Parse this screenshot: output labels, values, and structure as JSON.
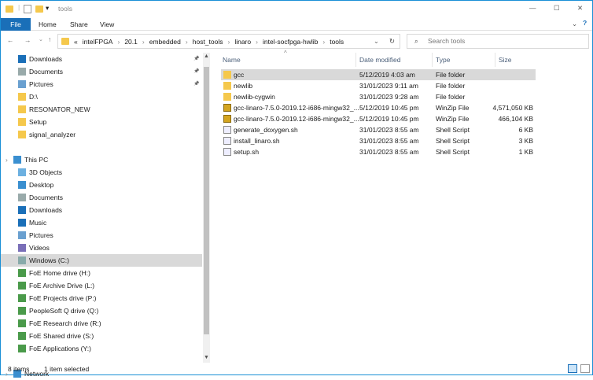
{
  "window": {
    "title": "tools",
    "minimize": "—",
    "maximize": "☐",
    "close": "✕"
  },
  "ribbon": {
    "tabs": [
      "File",
      "Home",
      "Share",
      "View"
    ]
  },
  "address": {
    "overflow": "«",
    "crumbs": [
      "intelFPGA",
      "20.1",
      "embedded",
      "host_tools",
      "linaro",
      "intel-socfpga-hwlib",
      "tools"
    ],
    "search_placeholder": "Search tools"
  },
  "nav": {
    "items": [
      {
        "label": "Downloads",
        "icon": "download-icon",
        "pinned": true
      },
      {
        "label": "Documents",
        "icon": "documents-icon",
        "pinned": true
      },
      {
        "label": "Pictures",
        "icon": "pictures-icon",
        "pinned": true
      },
      {
        "label": "D:\\",
        "icon": "folder-icon"
      },
      {
        "label": "RESONATOR_NEW",
        "icon": "folder-icon"
      },
      {
        "label": "Setup",
        "icon": "folder-icon"
      },
      {
        "label": "signal_analyzer",
        "icon": "folder-icon"
      },
      {
        "label": "",
        "icon": ""
      },
      {
        "label": "This PC",
        "icon": "pc-icon",
        "level": 0
      },
      {
        "label": "3D Objects",
        "icon": "3d-objects-icon"
      },
      {
        "label": "Desktop",
        "icon": "desktop-icon"
      },
      {
        "label": "Documents",
        "icon": "documents-icon"
      },
      {
        "label": "Downloads",
        "icon": "download-icon"
      },
      {
        "label": "Music",
        "icon": "music-icon"
      },
      {
        "label": "Pictures",
        "icon": "pictures-icon"
      },
      {
        "label": "Videos",
        "icon": "videos-icon"
      },
      {
        "label": "Windows (C:)",
        "icon": "drive-icon",
        "selected": true
      },
      {
        "label": "FoE Home drive (H:)",
        "icon": "network-drive-icon"
      },
      {
        "label": "FoE Archive Drive (L:)",
        "icon": "network-drive-icon"
      },
      {
        "label": "FoE Projects drive (P:)",
        "icon": "network-drive-icon"
      },
      {
        "label": "PeopleSoft Q drive (Q:)",
        "icon": "network-drive-icon"
      },
      {
        "label": "FoE Research drive (R:)",
        "icon": "network-drive-icon"
      },
      {
        "label": "FoE Shared drive (S:)",
        "icon": "network-drive-icon"
      },
      {
        "label": "FoE Applications (Y:)",
        "icon": "network-drive-icon"
      },
      {
        "label": "",
        "icon": ""
      },
      {
        "label": "Network",
        "icon": "network-icon",
        "level": 0
      }
    ]
  },
  "columns": {
    "name": "Name",
    "date": "Date modified",
    "type": "Type",
    "size": "Size"
  },
  "files": [
    {
      "name": "gcc",
      "date": "5/12/2019 4:03 am",
      "type": "File folder",
      "size": "",
      "kind": "folder"
    },
    {
      "name": "newlib",
      "date": "31/01/2023 9:11 am",
      "type": "File folder",
      "size": "",
      "kind": "folder"
    },
    {
      "name": "newlib-cygwin",
      "date": "31/01/2023 9:28 am",
      "type": "File folder",
      "size": "",
      "kind": "folder"
    },
    {
      "name": "gcc-linaro-7.5.0-2019.12-i686-mingw32_...",
      "date": "5/12/2019 10:45 pm",
      "type": "WinZip File",
      "size": "4,571,050 KB",
      "kind": "zip"
    },
    {
      "name": "gcc-linaro-7.5.0-2019.12-i686-mingw32_...",
      "date": "5/12/2019 10:45 pm",
      "type": "WinZip File",
      "size": "466,104 KB",
      "kind": "zip"
    },
    {
      "name": "generate_doxygen.sh",
      "date": "31/01/2023 8:55 am",
      "type": "Shell Script",
      "size": "6 KB",
      "kind": "script"
    },
    {
      "name": "install_linaro.sh",
      "date": "31/01/2023 8:55 am",
      "type": "Shell Script",
      "size": "3 KB",
      "kind": "script"
    },
    {
      "name": "setup.sh",
      "date": "31/01/2023 8:55 am",
      "type": "Shell Script",
      "size": "1 KB",
      "kind": "script"
    }
  ],
  "status": {
    "count": "8 items",
    "selected": "1 item selected"
  },
  "colors": {
    "accent": "#1a6fb8",
    "folder": "#f5c84c",
    "selected": "#d9d9d9"
  }
}
